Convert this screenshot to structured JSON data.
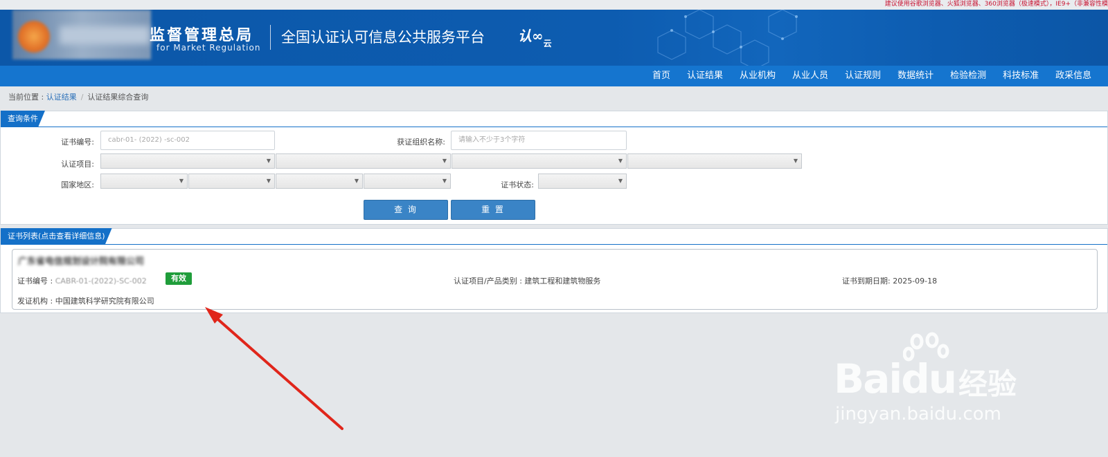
{
  "top_notice": "建议使用谷歌浏览器、火狐浏览器、360浏览器（极速模式），IE9+（非兼容性模",
  "header": {
    "org_name_cn": "监督管理总局",
    "org_name_en": "for Market Regulation",
    "platform_title": "全国认证认可信息公共服务平台",
    "platform_logo": "认",
    "platform_logo_sub": "云"
  },
  "nav": {
    "items": [
      "首页",
      "认证结果",
      "从业机构",
      "从业人员",
      "认证规则",
      "数据统计",
      "检验检测",
      "科技标准",
      "政采信息"
    ]
  },
  "breadcrumb": {
    "prefix": "当前位置 : ",
    "link": "认证结果",
    "separator": "/",
    "current": "认证结果综合查询"
  },
  "query_panel": {
    "title": "查询条件",
    "cert_no_label": "证书编号:",
    "cert_no_value": "cabr-01- (2022) -sc-002",
    "org_name_label": "获证组织名称:",
    "org_name_placeholder": "请输入不少于3个字符",
    "project_label": "认证项目:",
    "region_label": "国家地区:",
    "status_label": "证书状态:",
    "query_button": "查 询",
    "reset_button": "重 置"
  },
  "result_panel": {
    "title": "证书列表(点击查看详细信息)",
    "item": {
      "company": "广东省电信规划设计院有限公司",
      "cert_no_label": "证书编号 : ",
      "cert_no_value": "CABR-01-(2022)-SC-002",
      "status_badge": "有效",
      "project_label": "认证项目/产品类别 : ",
      "project_value": "建筑工程和建筑物服务",
      "expiry_label": "证书到期日期: ",
      "expiry_value": "2025-09-18",
      "issuer_label": "发证机构 : ",
      "issuer_value": "中国建筑科学研究院有限公司"
    }
  },
  "watermark": {
    "brand": "Bai",
    "brand2": "du",
    "brand_cn": "经验",
    "url": "jingyan.baidu.com"
  },
  "colors": {
    "banner": "#0c57a8",
    "nav": "#1575cf",
    "tab": "#1470c8",
    "button": "#3a84c6",
    "badge": "#1f9d3a",
    "arrow": "#e0261b",
    "notice": "#c8102e"
  }
}
